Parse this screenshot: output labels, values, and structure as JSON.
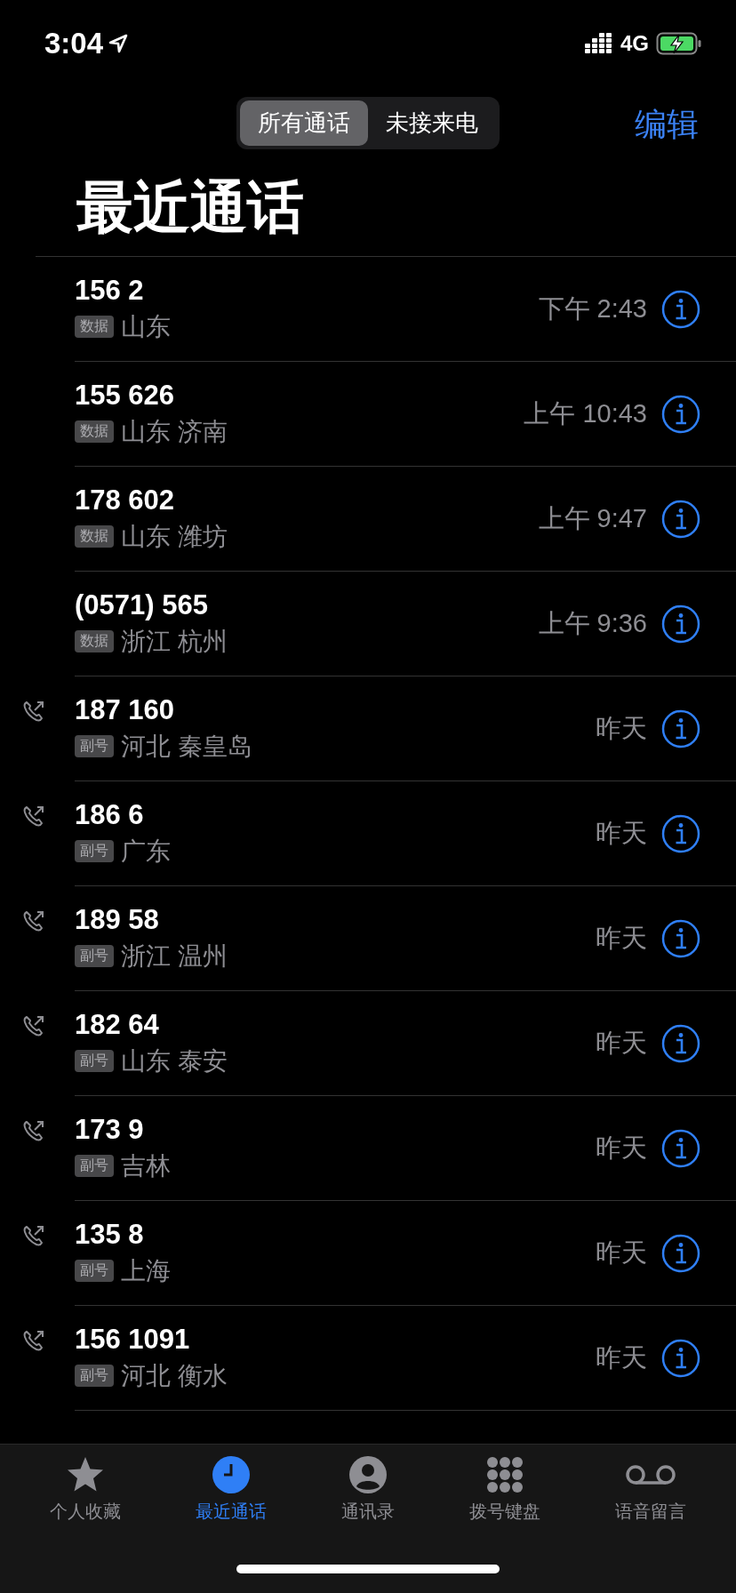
{
  "status_bar": {
    "time": "3:04",
    "network": "4G"
  },
  "segments": [
    {
      "label": "所有通话",
      "selected": true
    },
    {
      "label": "未接来电",
      "selected": false
    }
  ],
  "edit_button": "编辑",
  "title": "最近通话",
  "calls": [
    {
      "number": "156 2",
      "badge": "数据",
      "location": "山东",
      "time": "下午 2:43",
      "outgoing": false
    },
    {
      "number": "155 626",
      "badge": "数据",
      "location": "山东 济南",
      "time": "上午 10:43",
      "outgoing": false
    },
    {
      "number": "178 602",
      "badge": "数据",
      "location": "山东 潍坊",
      "time": "上午 9:47",
      "outgoing": false
    },
    {
      "number": "(0571) 565",
      "badge": "数据",
      "location": "浙江 杭州",
      "time": "上午 9:36",
      "outgoing": false
    },
    {
      "number": "187 160",
      "badge": "副号",
      "location": "河北 秦皇岛",
      "time": "昨天",
      "outgoing": true
    },
    {
      "number": "186 6",
      "badge": "副号",
      "location": "广东",
      "time": "昨天",
      "outgoing": true
    },
    {
      "number": "189 58",
      "badge": "副号",
      "location": "浙江 温州",
      "time": "昨天",
      "outgoing": true
    },
    {
      "number": "182 64",
      "badge": "副号",
      "location": "山东 泰安",
      "time": "昨天",
      "outgoing": true
    },
    {
      "number": "173 9",
      "badge": "副号",
      "location": "吉林",
      "time": "昨天",
      "outgoing": true
    },
    {
      "number": "135 8",
      "badge": "副号",
      "location": "上海",
      "time": "昨天",
      "outgoing": true
    },
    {
      "number": "156 1091",
      "badge": "副号",
      "location": "河北 衡水",
      "time": "昨天",
      "outgoing": true
    }
  ],
  "tabs": [
    {
      "kind": "favorites",
      "label": "个人收藏",
      "selected": false
    },
    {
      "kind": "recents",
      "label": "最近通话",
      "selected": true
    },
    {
      "kind": "contacts",
      "label": "通讯录",
      "selected": false
    },
    {
      "kind": "keypad",
      "label": "拨号键盘",
      "selected": false
    },
    {
      "kind": "voicemail",
      "label": "语音留言",
      "selected": false
    }
  ]
}
